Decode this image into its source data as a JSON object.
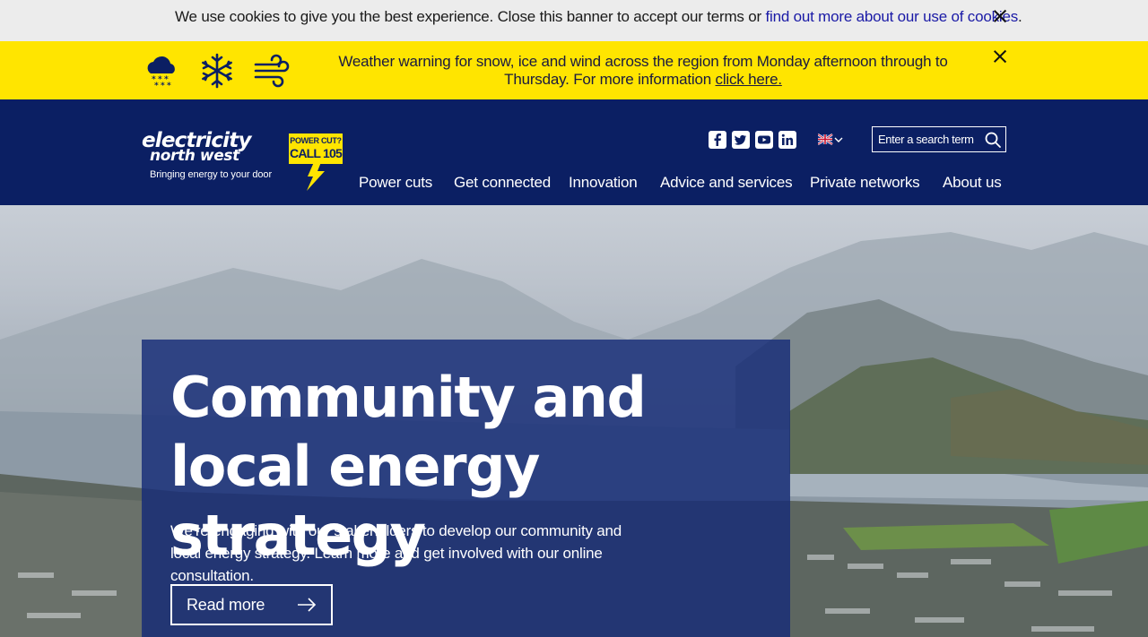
{
  "cookie_banner": {
    "text": "We use cookies to give you the best experience. Close this banner to accept our terms or ",
    "link": "find out more about our use of cookies",
    "end": "."
  },
  "weather_warning": {
    "text": "Weather warning for snow, ice and wind across the region from Monday afternoon through to Thursday. For more information ",
    "link": "click here."
  },
  "header": {
    "logo": {
      "line1": "electricity",
      "line2": "north west",
      "tagline": "Bringing energy to your door"
    },
    "power_cut": {
      "line1": "POWER CUT?",
      "line2": "CALL 105"
    },
    "search": {
      "placeholder": "Enter a search term"
    },
    "nav": [
      "Power cuts",
      "Get connected",
      "Innovation",
      "Advice and services",
      "Private networks",
      "About us"
    ]
  },
  "hero": {
    "title": "Community and local energy strategy",
    "description": "We're engaging with our stakeholders to develop our community and local energy strategy. Learn more and get involved with our online consultation.",
    "cta": "Read more"
  },
  "colors": {
    "brand_navy": "#0b1f63",
    "warning_yellow": "#ffe500",
    "cookie_bg": "#ececec"
  }
}
